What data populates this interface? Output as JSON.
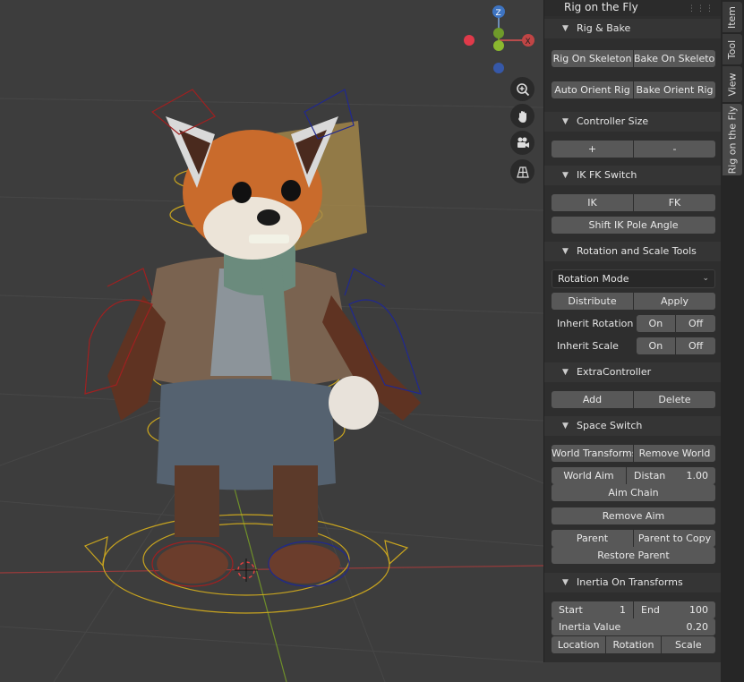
{
  "gizmo": {
    "z_label": "Z",
    "x_label": "X"
  },
  "viewport_nav": {
    "zoom": "zoom-icon",
    "hand": "hand-icon",
    "camera": "camera-icon",
    "grid": "grid-icon"
  },
  "panel": {
    "title": "Rig on the Fly",
    "rig_bake": {
      "header": "Rig & Bake",
      "rig_on_skeleton": "Rig On Skeleton",
      "bake_on_skeleton": "Bake On Skeleton",
      "auto_orient_rig": "Auto Orient Rig",
      "bake_orient_rig": "Bake Orient Rig"
    },
    "controller_size": {
      "header": "Controller Size",
      "plus": "+",
      "minus": "-"
    },
    "ik_fk": {
      "header": "IK FK Switch",
      "ik": "IK",
      "fk": "FK",
      "shift_pole": "Shift IK Pole Angle"
    },
    "rot_scale": {
      "header": "Rotation and Scale Tools",
      "mode": "Rotation Mode",
      "distribute": "Distribute",
      "apply": "Apply",
      "inherit_rotation": "Inherit Rotation",
      "inherit_scale": "Inherit Scale",
      "on": "On",
      "off": "Off"
    },
    "extra": {
      "header": "ExtraController",
      "add": "Add",
      "delete": "Delete"
    },
    "space": {
      "header": "Space Switch",
      "world_transforms": "World Transforms",
      "remove_world": "Remove World",
      "world_aim": "World Aim",
      "distance_label": "Distan",
      "distance_value": "1.00",
      "aim_chain": "Aim Chain",
      "remove_aim": "Remove Aim",
      "parent": "Parent",
      "parent_to_copy": "Parent to Copy",
      "restore_parent": "Restore Parent"
    },
    "inertia": {
      "header": "Inertia On Transforms",
      "start_label": "Start",
      "start_value": "1",
      "end_label": "End",
      "end_value": "100",
      "inertia_label": "Inertia Value",
      "inertia_value": "0.20",
      "location": "Location",
      "rotation": "Rotation",
      "scale": "Scale"
    }
  },
  "tabs": [
    "Item",
    "Tool",
    "View",
    "Rig on the Fly"
  ]
}
